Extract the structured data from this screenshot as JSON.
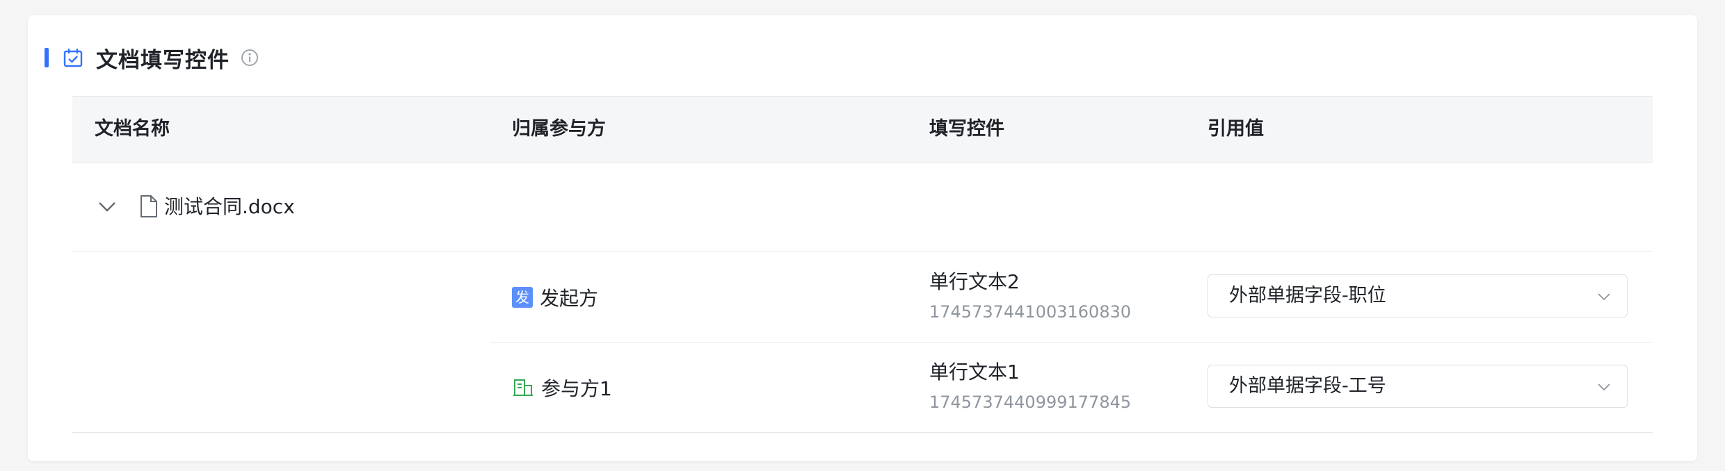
{
  "section": {
    "title": "文档填写控件",
    "accent_color": "#3370ff"
  },
  "table": {
    "columns": [
      "文档名称",
      "归属参与方",
      "填写控件",
      "引用值"
    ],
    "documents": [
      {
        "name": "测试合同.docx",
        "rows": [
          {
            "party_badge": "发",
            "party": "发起方",
            "field_name": "单行文本2",
            "field_id": "1745737441003160830",
            "ref_value": "外部单据字段-职位"
          },
          {
            "party_badge_icon": "org-building-icon",
            "party": "参与方1",
            "field_name": "单行文本1",
            "field_id": "1745737440999177845",
            "ref_value": "外部单据字段-工号"
          }
        ]
      }
    ]
  }
}
